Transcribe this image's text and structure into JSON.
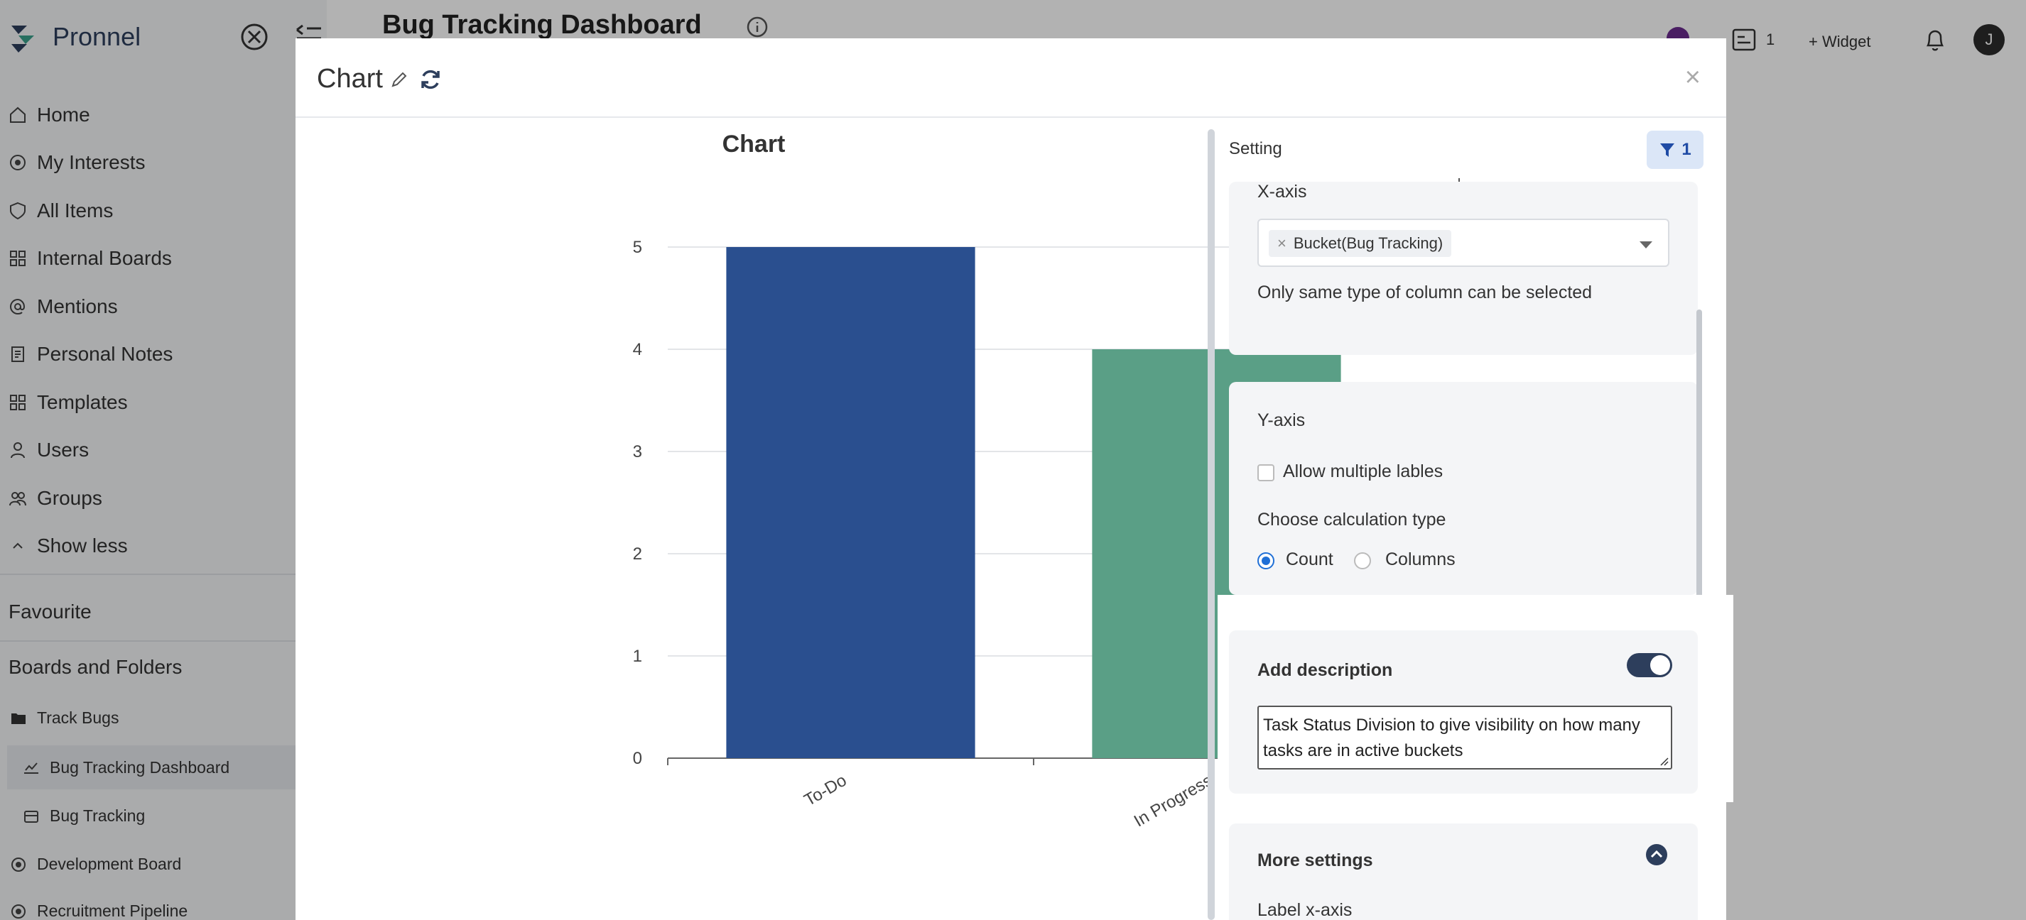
{
  "brand": {
    "name": "Pronnel"
  },
  "nav": {
    "items": [
      {
        "label": "Home",
        "icon": "home-icon"
      },
      {
        "label": "My Interests",
        "icon": "interests-icon"
      },
      {
        "label": "All Items",
        "icon": "shield-icon"
      },
      {
        "label": "Internal Boards",
        "icon": "boards-icon"
      },
      {
        "label": "Mentions",
        "icon": "at-icon"
      },
      {
        "label": "Personal Notes",
        "icon": "notes-icon"
      },
      {
        "label": "Templates",
        "icon": "templates-icon"
      },
      {
        "label": "Users",
        "icon": "user-icon"
      },
      {
        "label": "Groups",
        "icon": "groups-icon"
      },
      {
        "label": "Show less",
        "icon": "chevron-up-icon"
      }
    ]
  },
  "sections": {
    "favourite": "Favourite",
    "boards_and_folders": "Boards and Folders"
  },
  "tree": {
    "folder": "Track Bugs",
    "dashboard": "Bug Tracking Dashboard",
    "board": "Bug Tracking",
    "development": "Development Board",
    "recruitment": "Recruitment Pipeline"
  },
  "header": {
    "title": "Bug Tracking Dashboard",
    "count": "1",
    "widget": "+ Widget",
    "avatar": "J"
  },
  "modal": {
    "title": "Chart",
    "close": "×"
  },
  "chart_data": {
    "type": "bar",
    "title": "Chart",
    "categories": [
      "To-Do",
      "In Progress"
    ],
    "values": [
      5,
      4
    ],
    "colors": [
      "#2a4f8f",
      "#5a9f86"
    ],
    "yticks": [
      0,
      1,
      2,
      3,
      4,
      5
    ],
    "ylim": [
      0,
      5
    ],
    "grid": true
  },
  "settings": {
    "label": "Setting",
    "filter_count": "1",
    "xaxis": {
      "label": "X-axis",
      "selected_tag": "Bucket(Bug Tracking)",
      "tag_remove": "×",
      "hint": "Only same type of column can be selected"
    },
    "yaxis": {
      "label": "Y-axis",
      "allow_multiple": "Allow multiple lables",
      "calc_label": "Choose calculation type",
      "option_count": "Count",
      "option_columns": "Columns"
    },
    "description": {
      "label": "Add description",
      "text": "Task Status Division to give visibility on how many tasks are in active buckets"
    },
    "more": {
      "label": "More settings",
      "label_xaxis": "Label x-axis"
    }
  }
}
